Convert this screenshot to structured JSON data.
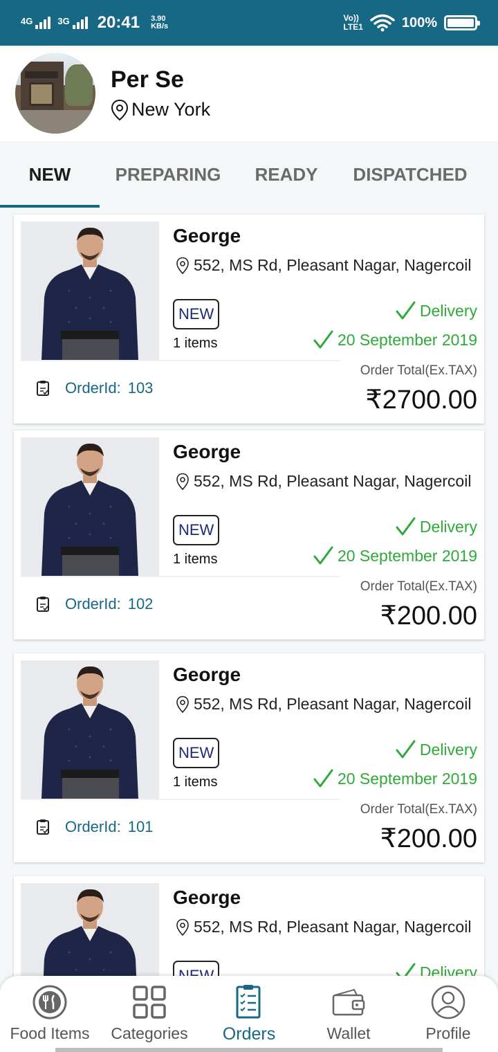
{
  "status_bar": {
    "net1": "4G",
    "net2": "3G",
    "time": "20:41",
    "speed_value": "3.90",
    "speed_unit": "KB/s",
    "volte": "Vo))",
    "lte": "LTE1",
    "battery": "100%"
  },
  "restaurant": {
    "name": "Per Se",
    "location": "New York"
  },
  "tabs": [
    {
      "label": "NEW",
      "active": true
    },
    {
      "label": "PREPARING",
      "active": false
    },
    {
      "label": "READY",
      "active": false
    },
    {
      "label": "DISPATCHED",
      "active": false
    }
  ],
  "orders": [
    {
      "customer": "George",
      "address": "552, MS Rd, Pleasant Nagar, Nagercoil",
      "status": "NEW",
      "items": "1 items",
      "delivery": "Delivery",
      "date": "20 September 2019",
      "total_label": "Order Total(Ex.TAX)",
      "total": "₹2700.00",
      "order_id_label": "OrderId:",
      "order_id": "103"
    },
    {
      "customer": "George",
      "address": "552, MS Rd, Pleasant Nagar, Nagercoil",
      "status": "NEW",
      "items": "1 items",
      "delivery": "Delivery",
      "date": "20 September 2019",
      "total_label": "Order Total(Ex.TAX)",
      "total": "₹200.00",
      "order_id_label": "OrderId:",
      "order_id": "102"
    },
    {
      "customer": "George",
      "address": "552, MS Rd, Pleasant Nagar, Nagercoil",
      "status": "NEW",
      "items": "1 items",
      "delivery": "Delivery",
      "date": "20 September 2019",
      "total_label": "Order Total(Ex.TAX)",
      "total": "₹200.00",
      "order_id_label": "OrderId:",
      "order_id": "101"
    },
    {
      "customer": "George",
      "address": "552, MS Rd, Pleasant Nagar, Nagercoil",
      "status": "NEW",
      "items": "",
      "delivery": "Delivery",
      "date": "",
      "total_label": "",
      "total": "",
      "order_id_label": "",
      "order_id": ""
    }
  ],
  "bottom_nav": [
    {
      "label": "Food Items",
      "icon": "food-icon",
      "active": false
    },
    {
      "label": "Categories",
      "icon": "grid-icon",
      "active": false
    },
    {
      "label": "Orders",
      "icon": "orders-icon",
      "active": true
    },
    {
      "label": "Wallet",
      "icon": "wallet-icon",
      "active": false
    },
    {
      "label": "Profile",
      "icon": "profile-icon",
      "active": false
    }
  ],
  "colors": {
    "primary": "#176884",
    "success": "#2faa3a",
    "badge_text": "#1c2a78"
  }
}
